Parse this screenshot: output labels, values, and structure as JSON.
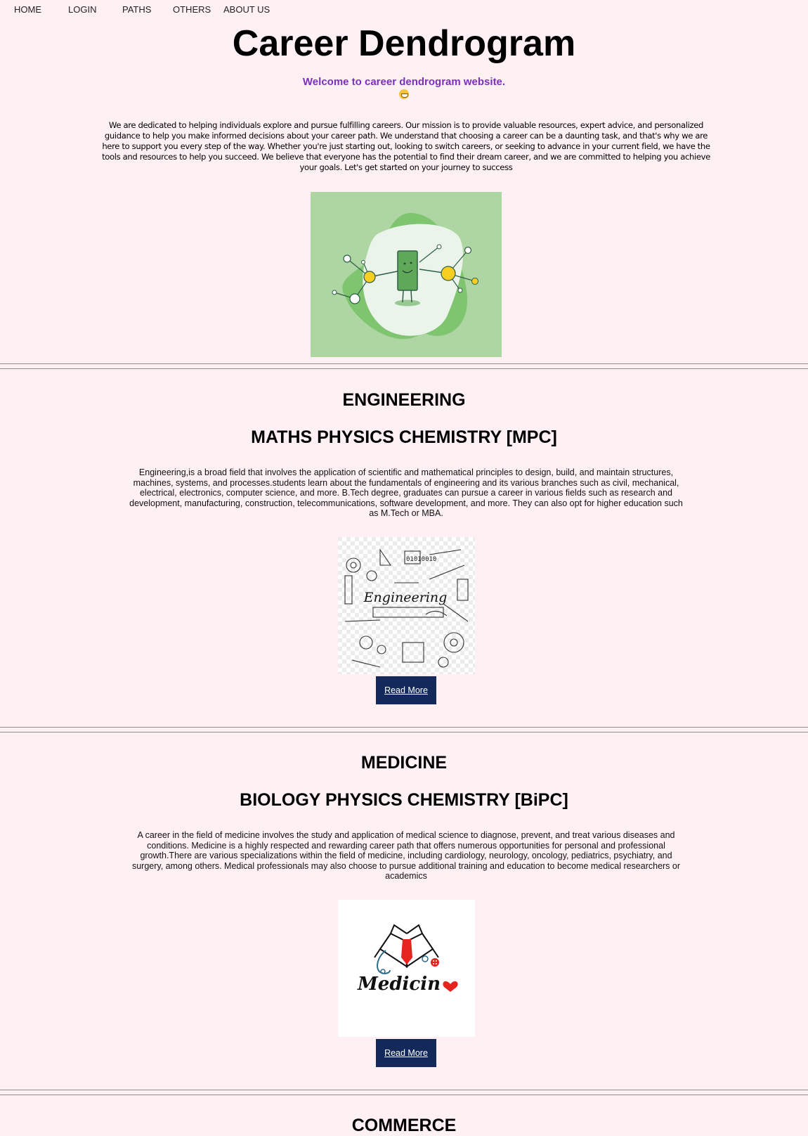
{
  "nav": {
    "items": [
      "HOME",
      "LOGIN",
      "PATHS",
      "OTHERS",
      "ABOUT US"
    ]
  },
  "header": {
    "title": "Career Dendrogram",
    "welcome": "Welcome to career dendrogram website.",
    "intro": "We are dedicated to helping individuals explore and pursue fulfilling careers. Our mission is to provide valuable resources, expert advice, and personalized guidance to help you make informed decisions about your career path. We understand that choosing a career can be a daunting task, and that's why we are here to support you every step of the way. Whether you're just starting out, looking to switch careers, or seeking to advance in your current field, we have the tools and resources to help you succeed. We believe that everyone has the potential to find their dream career, and we are committed to helping you achieve your goals. Let's get started on your journey to success"
  },
  "sections": [
    {
      "heading": "ENGINEERING",
      "subheading": "MATHS PHYSICS CHEMISTRY [MPC]",
      "text": "Engineering,is a broad field that involves the application of scientific and mathematical principles to design, build, and maintain structures, machines, systems, and processes.students learn about the fundamentals of engineering and its various branches such as civil, mechanical, electrical, electronics, computer science, and more. B.Tech degree, graduates can pursue a career in various fields such as research and development, manufacturing, construction, telecommunications, software development, and more. They can also opt for higher education such as M.Tech or MBA.",
      "image_word": "Engineering",
      "image_binary": "01010010",
      "button": "Read More"
    },
    {
      "heading": "MEDICINE",
      "subheading": "BIOLOGY PHYSICS CHEMISTRY [BiPC]",
      "text": "A career in the field of medicine involves the study and application of medical science to diagnose, prevent, and treat various diseases and conditions. Medicine is a highly respected and rewarding career path that offers numerous opportunities for personal and professional growth.There are various specializations within the field of medicine, including cardiology, neurology, oncology, pediatrics, psychiatry, and surgery, among others. Medical professionals may also choose to pursue additional training and education to become medical researchers or academics",
      "image_word": "Medicin",
      "button": "Read More"
    },
    {
      "heading": "COMMERCE"
    }
  ],
  "colors": {
    "background": "#fff0f4",
    "welcome": "#7b2fbf",
    "button": "#12295a",
    "hero_bg": "#add6a3"
  }
}
